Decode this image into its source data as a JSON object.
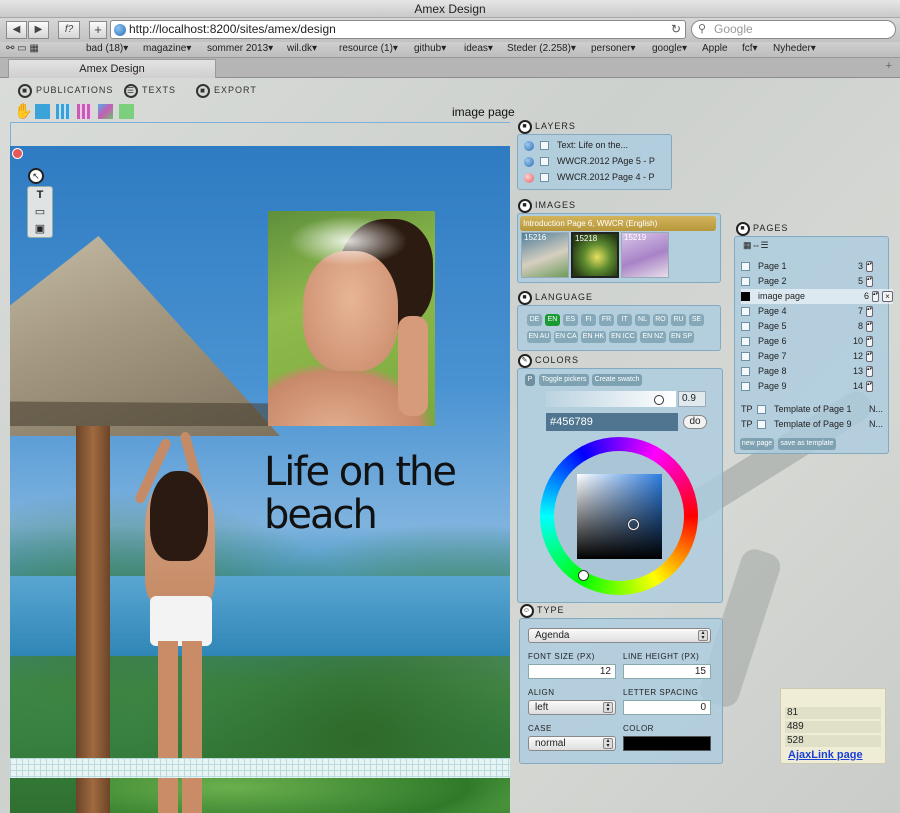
{
  "window": {
    "title": "Amex Design"
  },
  "toolbar": {
    "back": "◀",
    "forward": "▶",
    "func": "f?",
    "add": "+",
    "url": "http://localhost:8200/sites/amex/design",
    "search_placeholder": "Google"
  },
  "bookmarks": [
    "bad (18)▾",
    "magazine▾",
    "sommer 2013▾",
    "wil.dk▾",
    "resource (1)▾",
    "github▾",
    "ideas▾",
    "Steder (2.258)▾",
    "personer▾",
    "google▾",
    "Apple",
    "fcf▾",
    "Nyheder▾"
  ],
  "tab": {
    "label": "Amex Design"
  },
  "menu": {
    "publications": "PUBLICATIONS",
    "texts": "TEXTS",
    "export": "EXPORT"
  },
  "canvas": {
    "label": "image page",
    "headline": "Life on the beach"
  },
  "layers": {
    "title": "LAYERS",
    "items": [
      {
        "label": "Text: Life on the..."
      },
      {
        "label": "WWCR.2012 PAge 5 - P"
      },
      {
        "label": "WWCR.2012 Page 4 - P"
      }
    ]
  },
  "images": {
    "title": "IMAGES",
    "header": "Introduction Page 6, WWCR (English)",
    "thumbs": [
      "15216",
      "15218",
      "15219"
    ]
  },
  "language": {
    "title": "LANGUAGE",
    "row1": [
      "DE",
      "EN",
      "ES",
      "FI",
      "FR",
      "IT",
      "NL",
      "RO",
      "RU",
      "SE"
    ],
    "row2": [
      "EN AU",
      "EN CA",
      "EN HK",
      "EN ICC",
      "EN NZ",
      "EN SP"
    ],
    "active": "EN"
  },
  "colors": {
    "title": "COLORS",
    "p_label": "P",
    "toggle": "Toggle pickers",
    "create": "Create swatch",
    "opacity": "0.9",
    "hex": "#456789",
    "do": "do"
  },
  "type": {
    "title": "TYPE",
    "font": "Agenda",
    "font_size_label": "FONT SIZE (PX)",
    "font_size": "12",
    "line_height_label": "LINE HEIGHT (PX)",
    "line_height": "15",
    "align_label": "ALIGN",
    "align": "left",
    "letter_spacing_label": "LETTER SPACING",
    "letter_spacing": "0",
    "case_label": "CASE",
    "case": "normal",
    "color_label": "COLOR",
    "color_value": "#000000"
  },
  "pages": {
    "title": "PAGES",
    "view_toggle": "▦⇔☰",
    "rows": [
      {
        "label": "Page 1",
        "num": "3"
      },
      {
        "label": "Page 2",
        "num": "5"
      },
      {
        "label": "image page",
        "num": "6"
      },
      {
        "label": "Page 4",
        "num": "7"
      },
      {
        "label": "Page 5",
        "num": "8"
      },
      {
        "label": "Page 6",
        "num": "10"
      },
      {
        "label": "Page 7",
        "num": "12"
      },
      {
        "label": "Page 8",
        "num": "13"
      },
      {
        "label": "Page 9",
        "num": "14"
      }
    ],
    "templates": [
      {
        "tp": "TP",
        "label": "Template of Page 1",
        "n": "N..."
      },
      {
        "tp": "TP",
        "label": "Template of Page 9",
        "n": "N..."
      }
    ],
    "new_page": "new page",
    "save_template": "save as template"
  },
  "ajax": {
    "values": [
      "81",
      "489",
      "528"
    ],
    "link": "AjaxLink page"
  },
  "colors_theme": {
    "panel": "#aaccdf",
    "accent_gold": "#c9a84a",
    "lang_active": "#1a9a33",
    "link": "#1a3fd6"
  }
}
